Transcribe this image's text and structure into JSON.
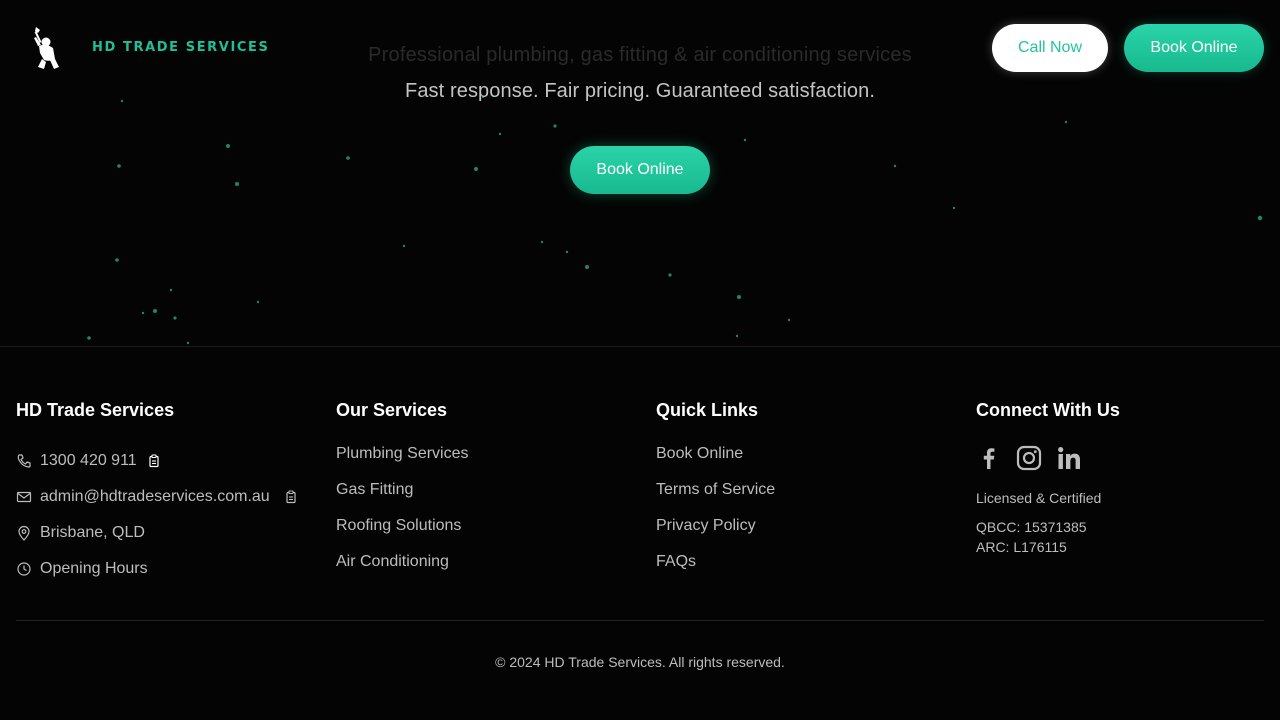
{
  "header": {
    "brand": "HD TRADE SERVICES",
    "call_label": "Call Now",
    "book_label": "Book Online",
    "logo_icon": "handyman-logo-icon"
  },
  "hero": {
    "faded_text": "Professional plumbing, gas fitting & air conditioning services",
    "subtitle": "Fast response. Fair pricing. Guaranteed satisfaction.",
    "cta_label": "Book Online",
    "accent_color": "#1fbf98"
  },
  "footer": {
    "company": {
      "heading": "HD Trade Services",
      "phone": "1300 420 911",
      "email": "admin@hdtradeservices.com.au",
      "location": "Brisbane, QLD",
      "hours": "Opening Hours"
    },
    "services": {
      "heading": "Our Services",
      "items": [
        "Plumbing Services",
        "Gas Fitting",
        "Roofing Solutions",
        "Air Conditioning"
      ]
    },
    "quick_links": {
      "heading": "Quick Links",
      "items": [
        "Book Online",
        "Terms of Service",
        "Privacy Policy",
        "FAQs"
      ]
    },
    "connect": {
      "heading": "Connect With Us",
      "socials": [
        "facebook-icon",
        "instagram-icon",
        "linkedin-icon"
      ],
      "cert_title": "Licensed & Certified",
      "qbcc": "QBCC: 15371385",
      "arc": "ARC: L176115"
    },
    "copyright": "© 2024 HD Trade Services. All rights reserved."
  },
  "colors": {
    "background": "#040404",
    "accent": "#1fbf98",
    "text_muted": "#bdbdbd",
    "heading": "#ffffff"
  }
}
